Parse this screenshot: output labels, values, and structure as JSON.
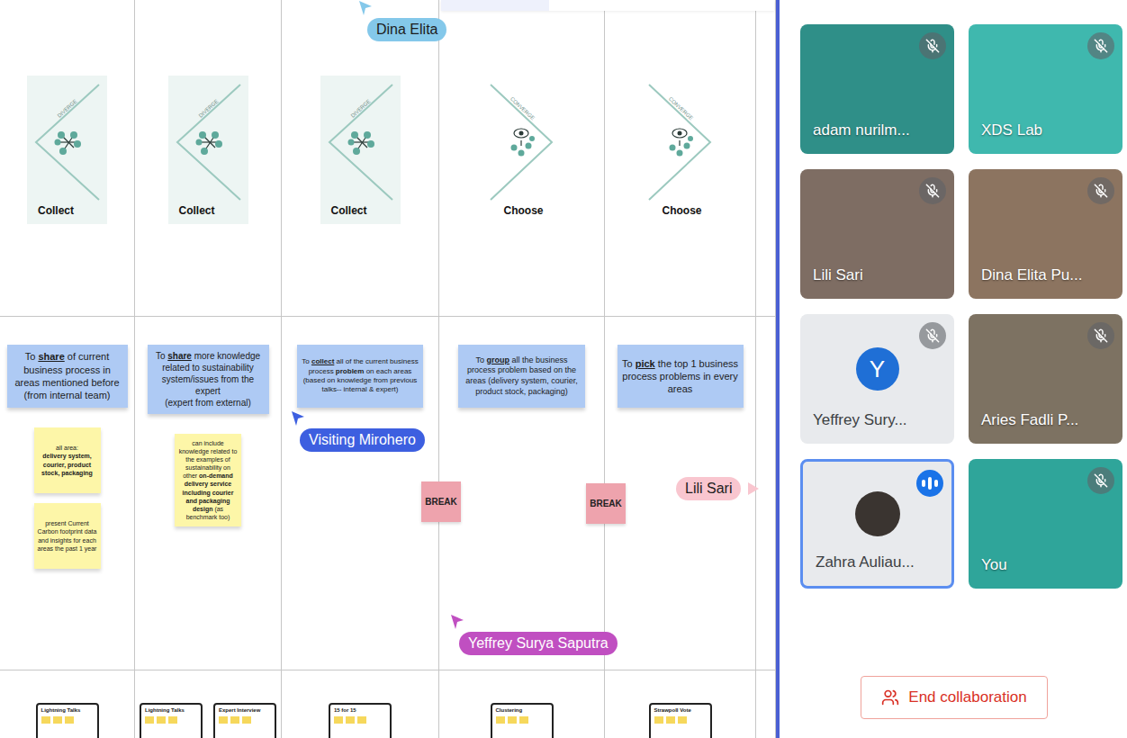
{
  "board": {
    "columns": [
      {
        "phase": {
          "kind": "diverge",
          "label": "DIVERGE",
          "action": "Collect"
        },
        "goal": [
          {
            "text": "To ",
            "bold": false,
            "underline": false,
            "newline": false
          },
          {
            "text": "share",
            "bold": true,
            "underline": true,
            "newline": false
          },
          {
            "text": " of current business process in areas mentioned before",
            "bold": false,
            "underline": false,
            "newline": false
          },
          {
            "text": "(from internal team)",
            "bold": false,
            "underline": false,
            "newline": true
          }
        ],
        "notes": [
          {
            "segments": [
              {
                "text": "all area:",
                "bold": false,
                "newline": false
              },
              {
                "text": "delivery system, courier, product stock,  packaging",
                "bold": true,
                "newline": true
              }
            ]
          },
          {
            "segments": [
              {
                "text": "present Current Carbon footprint data and insights for each areas the past 1 year",
                "bold": false,
                "newline": false
              }
            ]
          }
        ],
        "thumbnails": [
          {
            "title": "Lightning Talks"
          }
        ]
      },
      {
        "phase": {
          "kind": "diverge",
          "label": "DIVERGE",
          "action": "Collect"
        },
        "goal": [
          {
            "text": "To ",
            "bold": false,
            "underline": false,
            "newline": false
          },
          {
            "text": "share",
            "bold": true,
            "underline": true,
            "newline": false
          },
          {
            "text": " more knowledge related to sustainability system/issues from the expert",
            "bold": false,
            "underline": false,
            "newline": false
          },
          {
            "text": "(expert from external)",
            "bold": false,
            "underline": false,
            "newline": true
          }
        ],
        "notes": [
          {
            "segments": [
              {
                "text": "can include knowledge related to the examples of sustainability on other ",
                "bold": false,
                "newline": false
              },
              {
                "text": "on-demand delivery service including courier and packaging design",
                "bold": true,
                "newline": false
              },
              {
                "text": " (as benchmark too)",
                "bold": false,
                "newline": false
              }
            ]
          }
        ],
        "thumbnails": [
          {
            "title": "Lightning Talks"
          },
          {
            "title": "Expert Interview"
          }
        ]
      },
      {
        "phase": {
          "kind": "diverge",
          "label": "DIVERGE",
          "action": "Collect"
        },
        "goal": [
          {
            "text": "To ",
            "bold": false,
            "underline": false,
            "newline": false
          },
          {
            "text": "collect",
            "bold": true,
            "underline": true,
            "newline": false
          },
          {
            "text": " all of the current business process ",
            "bold": false,
            "underline": false,
            "newline": false
          },
          {
            "text": "problem",
            "bold": true,
            "underline": false,
            "newline": false
          },
          {
            "text": " on each areas",
            "bold": false,
            "underline": false,
            "newline": false
          },
          {
            "text": "(based on knowledge from previous talks-- internal & expert)",
            "bold": false,
            "underline": false,
            "newline": true
          }
        ],
        "notes": [],
        "thumbnails": [
          {
            "title": "15 for 15"
          }
        ]
      },
      {
        "phase": {
          "kind": "converge",
          "label": "CONVERGE",
          "action": "Choose"
        },
        "goal": [
          {
            "text": "To ",
            "bold": false,
            "underline": false,
            "newline": false
          },
          {
            "text": "group",
            "bold": true,
            "underline": true,
            "newline": false
          },
          {
            "text": " all the business process problem based on the areas (delivery system, courier, product stock, packaging)",
            "bold": false,
            "underline": false,
            "newline": false
          }
        ],
        "notes": [],
        "thumbnails": [
          {
            "title": "Clustering"
          }
        ]
      },
      {
        "phase": {
          "kind": "converge",
          "label": "CONVERGE",
          "action": "Choose"
        },
        "goal": [
          {
            "text": "To ",
            "bold": false,
            "underline": false,
            "newline": false
          },
          {
            "text": "pick",
            "bold": true,
            "underline": true,
            "newline": false
          },
          {
            "text": "  the top 1 business process problems in every areas",
            "bold": false,
            "underline": false,
            "newline": false
          }
        ],
        "notes": [],
        "thumbnails": [
          {
            "title": "Strawpoll Vote"
          }
        ]
      }
    ],
    "breaks": [
      {
        "label": "BREAK"
      },
      {
        "label": "BREAK"
      }
    ],
    "cursors": [
      {
        "name": "Dina Elita",
        "color": "#84c8ea",
        "offscreen": false
      },
      {
        "name": "Visiting Mirohero",
        "color": "#3d5fe0",
        "offscreen": false
      },
      {
        "name": "Yeffrey Surya Saputra",
        "color": "#c04fc1",
        "offscreen": false
      },
      {
        "name": "Lili Sari",
        "color": "#f9c6cf",
        "offscreen": true
      }
    ]
  },
  "participants": [
    {
      "name": "adam nurilm...",
      "kind": "video",
      "initial": "",
      "muted": true,
      "speaking": false,
      "color": "#2f8f88"
    },
    {
      "name": "XDS Lab",
      "kind": "video",
      "initial": "",
      "muted": true,
      "speaking": false,
      "color": "#3fb8ae"
    },
    {
      "name": "Lili Sari",
      "kind": "video",
      "initial": "",
      "muted": true,
      "speaking": false,
      "color": "#7e6d63"
    },
    {
      "name": "Dina Elita Pu...",
      "kind": "video",
      "initial": "",
      "muted": true,
      "speaking": false,
      "color": "#8c7460"
    },
    {
      "name": "Yeffrey Sury...",
      "kind": "letter",
      "initial": "Y",
      "muted": true,
      "speaking": false,
      "color": "#1f6fd6"
    },
    {
      "name": "Aries Fadli P...",
      "kind": "video",
      "initial": "",
      "muted": true,
      "speaking": false,
      "color": "#7d7262"
    },
    {
      "name": "Zahra Auliau...",
      "kind": "photo",
      "initial": "",
      "muted": false,
      "speaking": true,
      "color": "#3a3430"
    },
    {
      "name": "You",
      "kind": "video",
      "initial": "",
      "muted": true,
      "speaking": false,
      "color": "#2fa59a"
    }
  ],
  "end_button": {
    "label": "End collaboration"
  }
}
